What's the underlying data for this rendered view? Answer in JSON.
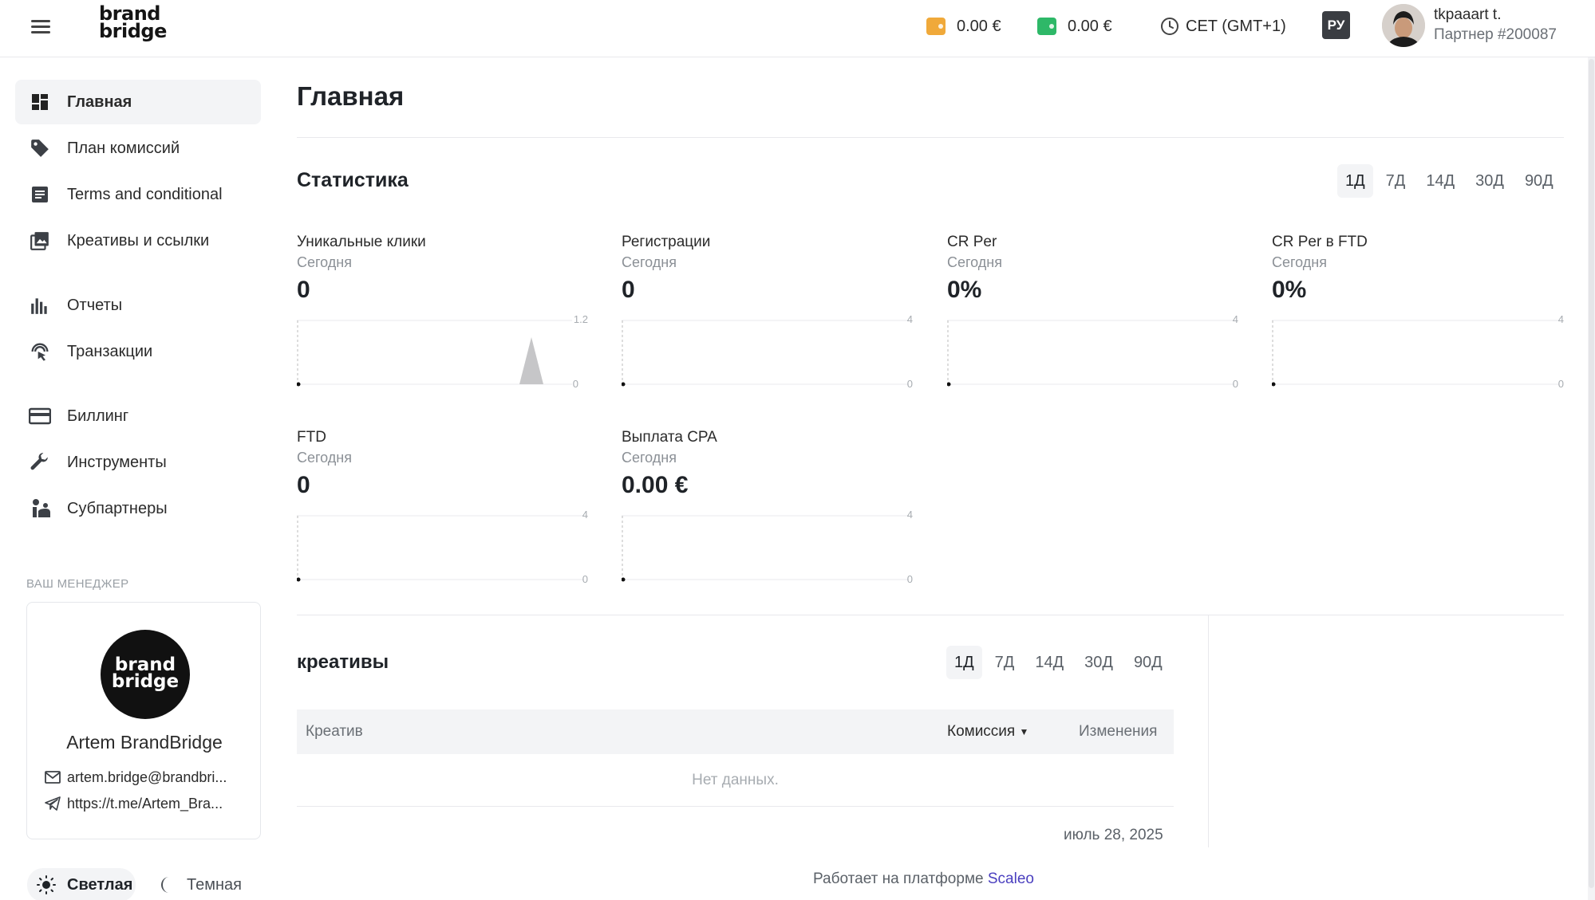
{
  "header": {
    "logo_line1": "brand",
    "logo_line2": "bridge",
    "balance_main": "0.00 €",
    "balance_second": "0.00 €",
    "timezone": "CET (GMT+1)",
    "language": "РУ",
    "user_name": "tkpaaart t.",
    "user_id": "Партнер #200087",
    "colors": {
      "wallet_orange": "#f0a93a",
      "wallet_green": "#2eb868"
    }
  },
  "sidebar": {
    "items": [
      {
        "label": "Главная",
        "icon": "dashboard-icon"
      },
      {
        "label": "План комиссий",
        "icon": "tag-icon"
      },
      {
        "label": "Terms and conditional",
        "icon": "document-icon"
      },
      {
        "label": "Креативы и ссылки",
        "icon": "image-gallery-icon"
      },
      {
        "label": "Отчеты",
        "icon": "bar-chart-icon"
      },
      {
        "label": "Транзакции",
        "icon": "touch-icon"
      },
      {
        "label": "Биллинг",
        "icon": "credit-card-icon"
      },
      {
        "label": "Инструменты",
        "icon": "wrench-icon"
      },
      {
        "label": "Субпартнеры",
        "icon": "people-icon"
      }
    ],
    "manager": {
      "title": "ВАШ МЕНЕДЖЕР",
      "logo_line1": "brand",
      "logo_line2": "bridge",
      "name": "Artem BrandBridge",
      "email": "artem.bridge@brandbri...",
      "telegram": "https://t.me/Artem_Bra..."
    },
    "theme": {
      "light": "Светлая",
      "dark": "Темная"
    }
  },
  "main": {
    "title": "Главная",
    "stats": {
      "title": "Статистика",
      "periods": [
        "1Д",
        "7Д",
        "14Д",
        "30Д",
        "90Д"
      ],
      "active_period": "1Д",
      "cards": [
        {
          "label": "Уникальные клики",
          "sub": "Сегодня",
          "value": "0",
          "ymax": "1.2",
          "ymin": "0"
        },
        {
          "label": "Регистрации",
          "sub": "Сегодня",
          "value": "0",
          "ymax": "4",
          "ymin": "0"
        },
        {
          "label": "CR Per",
          "sub": "Сегодня",
          "value": "0%",
          "ymax": "4",
          "ymin": "0"
        },
        {
          "label": "CR Per в FTD",
          "sub": "Сегодня",
          "value": "0%",
          "ymax": "4",
          "ymin": "0"
        },
        {
          "label": "FTD",
          "sub": "Сегодня",
          "value": "0",
          "ymax": "4",
          "ymin": "0"
        },
        {
          "label": "Выплата CPA",
          "sub": "Сегодня",
          "value": "0.00 €",
          "ymax": "4",
          "ymin": "0"
        }
      ]
    },
    "creatives": {
      "title": "креативы",
      "periods": [
        "1Д",
        "7Д",
        "14Д",
        "30Д",
        "90Д"
      ],
      "active_period": "1Д",
      "columns": [
        "Креатив",
        "Комиссия",
        "Изменения"
      ],
      "empty_text": "Нет данных.",
      "date": "июль 28, 2025"
    },
    "footer": {
      "text": "Работает на платформе ",
      "link": "Scaleo"
    }
  }
}
